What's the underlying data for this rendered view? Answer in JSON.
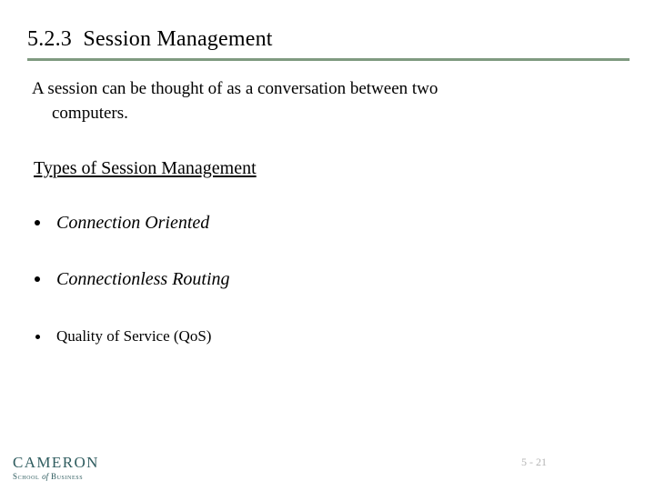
{
  "slide": {
    "title": "5.2.3  Session Management",
    "rule_color": "#7f9a80",
    "background_color": "#ffffff",
    "paragraph": {
      "line1": "A session can be thought of as a conversation between two",
      "line2": "computers."
    },
    "subheading": "Types of Session Management",
    "bullets": [
      {
        "marker": "bullet-dot",
        "label": "Connection Oriented"
      },
      {
        "marker": "bullet-dot",
        "label": "Connectionless Routing"
      },
      {
        "marker": "bullet-dot",
        "label": "Quality of Service (QoS)"
      }
    ]
  },
  "footer": {
    "logo": {
      "name": "CAMERON",
      "tagline_pre": "School ",
      "tagline_of": "of",
      "tagline_post": " Business",
      "color": "#2f5c5f"
    },
    "page_number": "5 - 21",
    "page_number_color": "#b4b4b4"
  }
}
